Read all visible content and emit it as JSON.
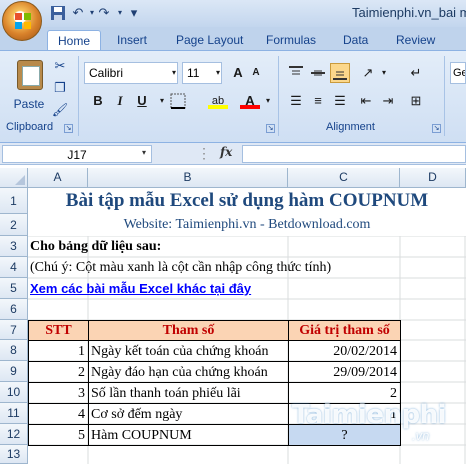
{
  "window_title": "Taimienphi.vn_bai ma",
  "tabs": [
    "Home",
    "Insert",
    "Page Layout",
    "Formulas",
    "Data",
    "Review"
  ],
  "ribbon": {
    "paste_label": "Paste",
    "clipboard_label": "Clipboard",
    "font_name": "Calibri",
    "font_size": "11",
    "bold": "B",
    "italic": "I",
    "underline": "U",
    "grow_font": "A",
    "shrink_font": "A",
    "font_color": "A",
    "highlight": "ab",
    "alignment_label": "Alignment",
    "general_partial": "Ge"
  },
  "formula_bar": {
    "name_box": "J17",
    "fx": "fx",
    "formula": ""
  },
  "columns": [
    "A",
    "B",
    "C",
    "D"
  ],
  "rows": [
    "1",
    "2",
    "3",
    "4",
    "5",
    "6",
    "7",
    "8",
    "9",
    "10",
    "11",
    "12",
    "13"
  ],
  "sheet": {
    "title": "Bài tập mẫu Excel sử dụng hàm COUPNUM",
    "website": "Website: Taimienphi.vn - Betdownload.com",
    "intro": "Cho bảng dữ liệu sau:",
    "note": "(Chú ý: Cột màu xanh là cột cần nhập công thức tính)",
    "link": "Xem các bài mẫu Excel khác tại đây",
    "table_header": [
      "STT",
      "Tham số",
      "Giá trị tham số"
    ],
    "table_rows": [
      {
        "stt": "1",
        "param": "Ngày kết toán của chứng khoán",
        "value": "20/02/2014"
      },
      {
        "stt": "2",
        "param": "Ngày đáo hạn của chứng khoán",
        "value": "29/09/2014"
      },
      {
        "stt": "3",
        "param": "Số lần thanh toán phiếu lãi",
        "value": "2"
      },
      {
        "stt": "4",
        "param": "Cơ sở đếm ngày",
        "value": "1"
      },
      {
        "stt": "5",
        "param": "Hàm COUPNUM",
        "value": "?"
      }
    ]
  },
  "watermark": {
    "brand": "Taimienphi",
    "suffix": ".vn"
  },
  "colors": {
    "header_fill": "#fbd4b4",
    "header_text": "#c00000",
    "calc_fill": "#c6d9f1",
    "title_text": "#1f497d",
    "link_text": "#0000ff"
  }
}
